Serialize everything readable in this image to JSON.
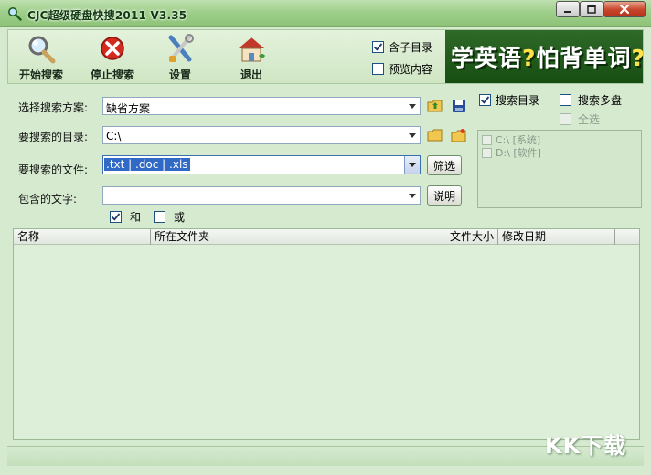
{
  "window": {
    "title": "CJC超级硬盘快搜2011 V3.35"
  },
  "toolbar": {
    "start_label": "开始搜索",
    "stop_label": "停止搜索",
    "settings_label": "设置",
    "exit_label": "退出",
    "include_subdirs_label": "含子目录",
    "preview_label": "预览内容"
  },
  "banner": {
    "text_a": "学英语",
    "text_b": "怕背单词"
  },
  "form": {
    "scheme_label": "选择搜索方案:",
    "scheme_value": "缺省方案",
    "dir_label": "要搜索的目录:",
    "dir_value": "C:\\",
    "files_label": "要搜索的文件:",
    "files_value": ".txt | .doc | .xls",
    "filter_button": "筛选",
    "text_label": "包含的文字:",
    "text_value": "",
    "help_button": "说明",
    "and_label": "和",
    "or_label": "或"
  },
  "options": {
    "search_dir_label": "搜索目录",
    "multi_disk_label": "搜索多盘",
    "select_all_label": "全选"
  },
  "drives": [
    {
      "label": "C:\\ [系统]"
    },
    {
      "label": "D:\\ [软件]"
    }
  ],
  "results": {
    "columns": [
      "名称",
      "所在文件夹",
      "文件大小",
      "修改日期"
    ]
  },
  "watermark": "KK下载"
}
